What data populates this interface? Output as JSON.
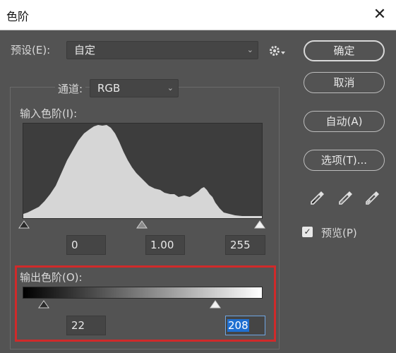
{
  "window": {
    "title": "色阶",
    "close": "✕"
  },
  "preset": {
    "label": "预设(E):",
    "value": "自定"
  },
  "channel": {
    "label": "通道:",
    "value": "RGB"
  },
  "input_levels": {
    "label": "输入色阶(I):",
    "black": "0",
    "gamma": "1.00",
    "white": "255"
  },
  "output_levels": {
    "label": "输出色阶(O):",
    "black": "22",
    "white": "208"
  },
  "buttons": {
    "ok": "确定",
    "cancel": "取消",
    "auto": "自动(A)",
    "options": "选项(T)..."
  },
  "preview": {
    "label": "预览(P)",
    "checked": true
  },
  "colors": {
    "dialog_bg": "#535353",
    "histogram_fill": "#d6d6d6",
    "highlight_border": "#d02a2a",
    "selection": "#1f6fd1"
  }
}
